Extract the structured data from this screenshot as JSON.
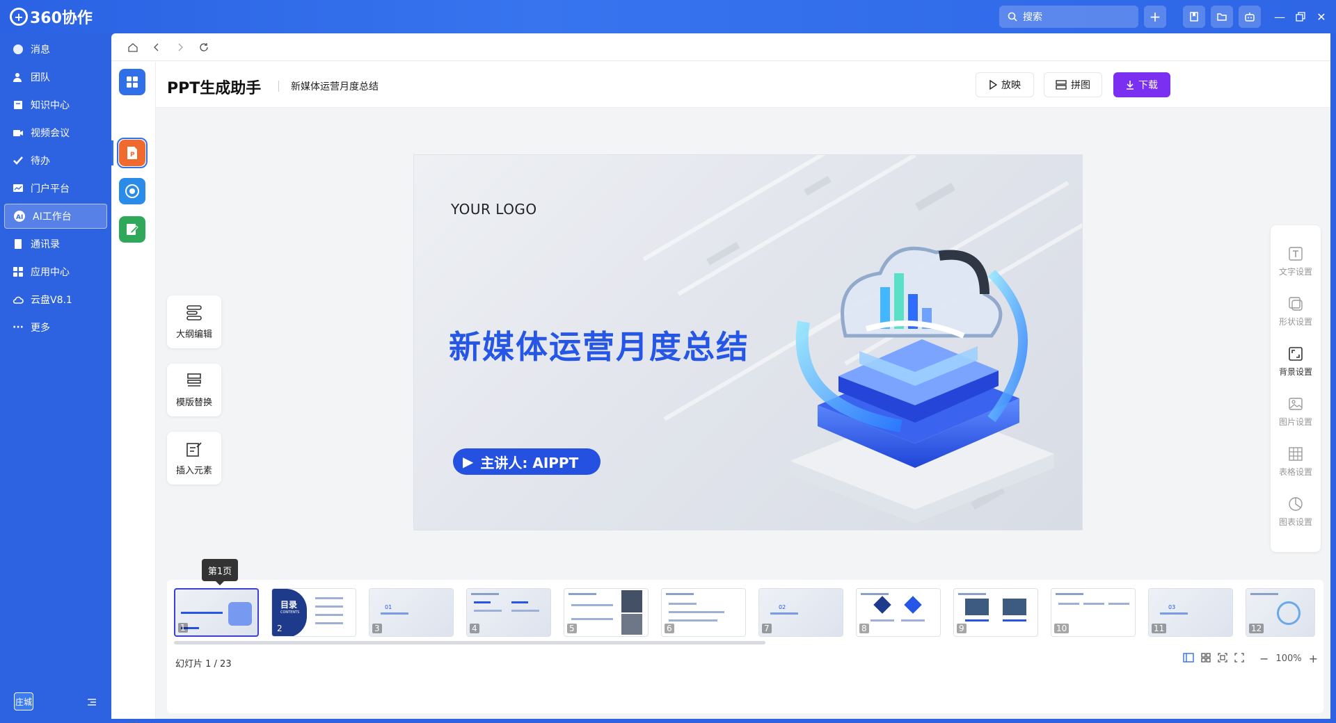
{
  "app": {
    "brand": "360协作"
  },
  "topbar": {
    "search_placeholder": "搜索"
  },
  "sidebar": {
    "items": [
      {
        "label": "消息",
        "icon": "message-icon"
      },
      {
        "label": "团队",
        "icon": "team-icon"
      },
      {
        "label": "知识中心",
        "icon": "knowledge-icon"
      },
      {
        "label": "视频会议",
        "icon": "video-icon"
      },
      {
        "label": "待办",
        "icon": "todo-icon"
      },
      {
        "label": "门户平台",
        "icon": "portal-icon"
      },
      {
        "label": "AI工作台",
        "icon": "ai-icon",
        "active": true
      },
      {
        "label": "通讯录",
        "icon": "contacts-icon"
      },
      {
        "label": "应用中心",
        "icon": "apps-icon"
      },
      {
        "label": "云盘V8.1",
        "icon": "cloud-icon"
      },
      {
        "label": "更多",
        "icon": "more-icon"
      }
    ],
    "user_badge": "庄城"
  },
  "workspace": {
    "title": "PPT生成助手",
    "doc_name": "新媒体运营月度总结",
    "actions": {
      "play": "放映",
      "collage": "拼图",
      "download": "下载"
    },
    "tools": [
      "大纲编辑",
      "模版替换",
      "插入元素"
    ]
  },
  "slide": {
    "logo": "YOUR LOGO",
    "title": "新媒体运营月度总结",
    "presenter": "主讲人: AIPPT"
  },
  "props": [
    "文字设置",
    "形状设置",
    "背景设置",
    "图片设置",
    "表格设置",
    "图表设置"
  ],
  "thumbnails": {
    "tooltip": "第1页",
    "items": [
      "1",
      "2",
      "3",
      "4",
      "5",
      "6",
      "7",
      "8",
      "9",
      "10",
      "11",
      "12"
    ],
    "toc_title": "目录",
    "toc_sub": "CONTENTS",
    "section_01": "01",
    "section_02": "02",
    "section_03": "03"
  },
  "status": {
    "slide_count": "幻灯片  1 / 23",
    "zoom": "100%"
  },
  "colors": {
    "brand_blue": "#2f6fe8",
    "primary_purple": "#7b2ff0",
    "slide_title": "#2556e6"
  }
}
